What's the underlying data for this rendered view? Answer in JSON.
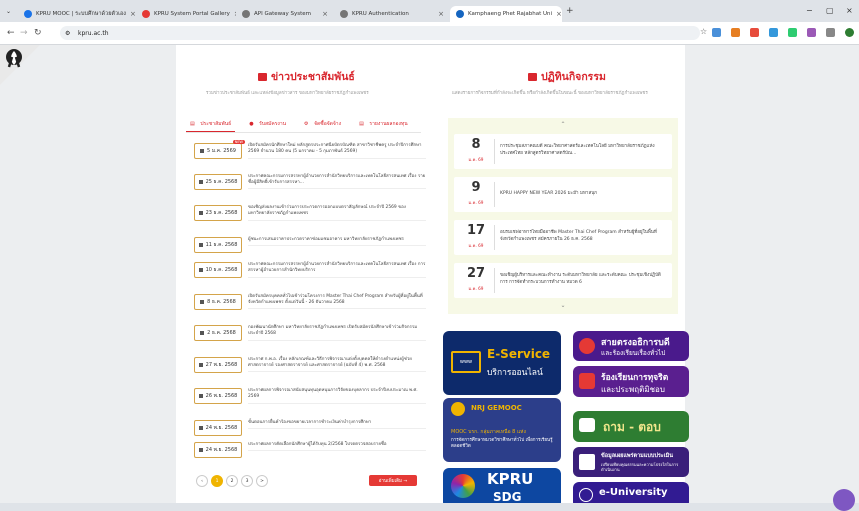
{
  "browser": {
    "tabs": [
      {
        "label": "KPRU MOOC | ระบบศึกษาด้วยตัวเอง",
        "color": "#1a73e8"
      },
      {
        "label": "KPRU System Portal Gallery",
        "color": "#e53935"
      },
      {
        "label": "API Gateway System",
        "color": "#757575"
      },
      {
        "label": "KPRU Authentication",
        "color": "#757575"
      },
      {
        "label": "Kamphaeng Phet Rajabhat Uni",
        "color": "#1565c0"
      }
    ],
    "new_tab": "+",
    "url": "kpru.ac.th"
  },
  "news": {
    "title": "ข่าวประชาสัมพันธ์",
    "subtitle": "รวมข่าวประชาสัมพันธ์ และแหล่งข้อมูลข่าวสาร ของมหาวิทยาลัยราชภัฏกำแพงเพชร",
    "tabs": [
      "ประชาสัมพันธ์",
      "รับสมัครงาน",
      "จัดซื้อจัดจ้าง",
      "รายงานผลกองทุน"
    ],
    "new_badge": "NEW",
    "items": [
      {
        "date": "5 ม.ค. 2569",
        "text": "เปิดรับสมัครนักศึกษาใหม่ หลักสูตรประกาศนียบัตรบัณฑิต สาขาวิชาชีพครู ประจำปีการศึกษา 2569 จำนวน 180 คน (5 มกราคม - 5 กุมภาพันธ์ 2569)"
      },
      {
        "date": "25 ธ.ค. 2568",
        "text": "ประกาศคณะกรรมการสรรหาผู้อำนวยการสำนักวิทยบริการและเทคโนโลยีสารสนเทศ เรื่อง รายชื่อผู้มีสิทธิ์เข้ารับการสรรหา..."
      },
      {
        "date": "23 ธ.ค. 2568",
        "text": "ขอเชิญส่งผลงานเข้าร่วมการประกวดการออกแบบตราสัญลักษณ์ ประจำปี 2569 ของมหาวิทยาลัยราชภัฏกำแพงเพชร"
      },
      {
        "date": "11 ธ.ค. 2568",
        "text": "ผู้ชนะการเสนอราคาประกวดราคาซ่อมแซมอาคาร มหาวิทยาลัยราชภัฏกำแพงเพชร"
      },
      {
        "date": "10 ธ.ค. 2568",
        "text": "ประกาศคณะกรรมการสรรหาผู้อำนวยการสำนักวิทยบริการและเทคโนโลยีสารสนเทศ เรื่อง การสรรหาผู้อำนวยการสำนักวิทยบริการ"
      },
      {
        "date": "8 ธ.ค. 2568",
        "text": "เปิดรับสมัครบุคคลทั่วไปเข้าร่วมโครงการ Master Thai Chef Program สำหรับผู้ที่อยู่ในพื้นที่จังหวัดกำแพงเพชร ตั้งแต่วันนี้ - 26 ธันวาคม 2568"
      },
      {
        "date": "2 ธ.ค. 2568",
        "text": "กองพัฒนานักศึกษา มหาวิทยาลัยราชภัฏกำแพงเพชร เปิดรับสมัครนักศึกษาเข้าร่วมกิจกรรม ประจำปี 2568"
      },
      {
        "date": "27 พ.ย. 2568",
        "text": "ประกาศ ก.พ.อ. เรื่อง หลักเกณฑ์และวิธีการพิจารณาแต่งตั้งบุคคลให้ดำรงตำแหน่งผู้ช่วยศาสตราจารย์ รองศาสตราจารย์ และศาสตราจารย์ (ฉบับที่ 4) พ.ศ. 2568"
      },
      {
        "date": "26 พ.ย. 2568",
        "text": "ประกาศผลการพิจารณาสนับสนุนทุนอุดหนุนการวิจัยของบุคลากร ประจำปีงบประมาณ พ.ศ. 2569"
      },
      {
        "date": "24 พ.ย. 2568",
        "text": "ขั้นตอนการยื่นคำร้องขอขยายเวลาการชำระเงินค่าบำรุงการศึกษา"
      },
      {
        "date": "24 พ.ย. 2568",
        "text": "ประกาศผลการคัดเลือกนักศึกษาผู้ได้รับทุน 2/2568 โปรดตรวจสอบรายชื่อ"
      }
    ],
    "pages": [
      "1",
      "2",
      "3",
      ">"
    ],
    "more": "อ่านเพิ่มเติม →"
  },
  "activity": {
    "title": "ปฏิทินกิจกรรม",
    "subtitle": "แสดงรายการกิจกรรมที่กำลังจะเกิดขึ้น หรือกำลังเกิดขึ้นในขณะนี้ ของมหาวิทยาลัยราชภัฏกำแพงเพชร",
    "up": "⌃",
    "down": "⌄",
    "items": [
      {
        "day": "8",
        "mon": "ม.ค. 69",
        "text": "การประชุมสภาคณบดี คณะวิทยาศาสตร์และเทคโนโลยี มหาวิทยาลัยราชภัฏแห่งประเทศไทย หลักสูตรวิทยาศาสตร์บัณ..."
      },
      {
        "day": "9",
        "mon": "ม.ค. 69",
        "text": "KPRU HAPPY NEW YEAR 2026 มะม๊า มหาสนุก"
      },
      {
        "day": "17",
        "mon": "ม.ค. 69",
        "text": "อบรมเชฟอาหารไทยมืออาชีพ Master Thai Chef Program สำหรับผู้ที่อยู่ในพื้นที่จังหวัดกำแพงเพชร สมัครภายใน 26 ธ.ค. 2568"
      },
      {
        "day": "27",
        "mon": "ม.ค. 69",
        "text": "ขอเชิญผู้บริหารและคณะทำงาน ระดับมหาวิทยาลัย และระดับคณะ ประชุมเชิงปฏิบัติการ การจัดทำกระบวนการทำงาน หมวด 6"
      }
    ]
  },
  "banners": {
    "eservice_title": "E-Service",
    "eservice_sub": "บริการออนไลน์",
    "www": "www",
    "complaint_title": "สายตรงอธิการบดี",
    "complaint_sub": "และร้องเรียนเรื่องทั่วไป",
    "corrupt_title": "ร้องเรียนการทุจริต",
    "corrupt_sub": "และประพฤติมิชอบ",
    "mooc_title": "NRJ GEMOOC",
    "mooc_small": "MOOC บรก. กลุ่มภาคเหนือ 8 แห่ง",
    "mooc_sub": "การจัดการศึกษาหมวดวิชาศึกษาทั่วไป เพื่อการเรียนรู้ตลอดชีวิต",
    "qa_title": "ถาม - ตอบ",
    "ita_title": "ข้อมูลเผยแพร่ตามแบบประเมิน",
    "ita_sub": "เปรียบเทียบคุณธรรมและความโปร่งใสในการดำเนินงาน",
    "sdg_title": "KPRU",
    "sdg_sub": "SDG",
    "euniv_title": "e-University"
  },
  "colors": {
    "accent": "#d9272e",
    "gold": "#f0b400",
    "activity_bg": "#f7f9e6"
  }
}
